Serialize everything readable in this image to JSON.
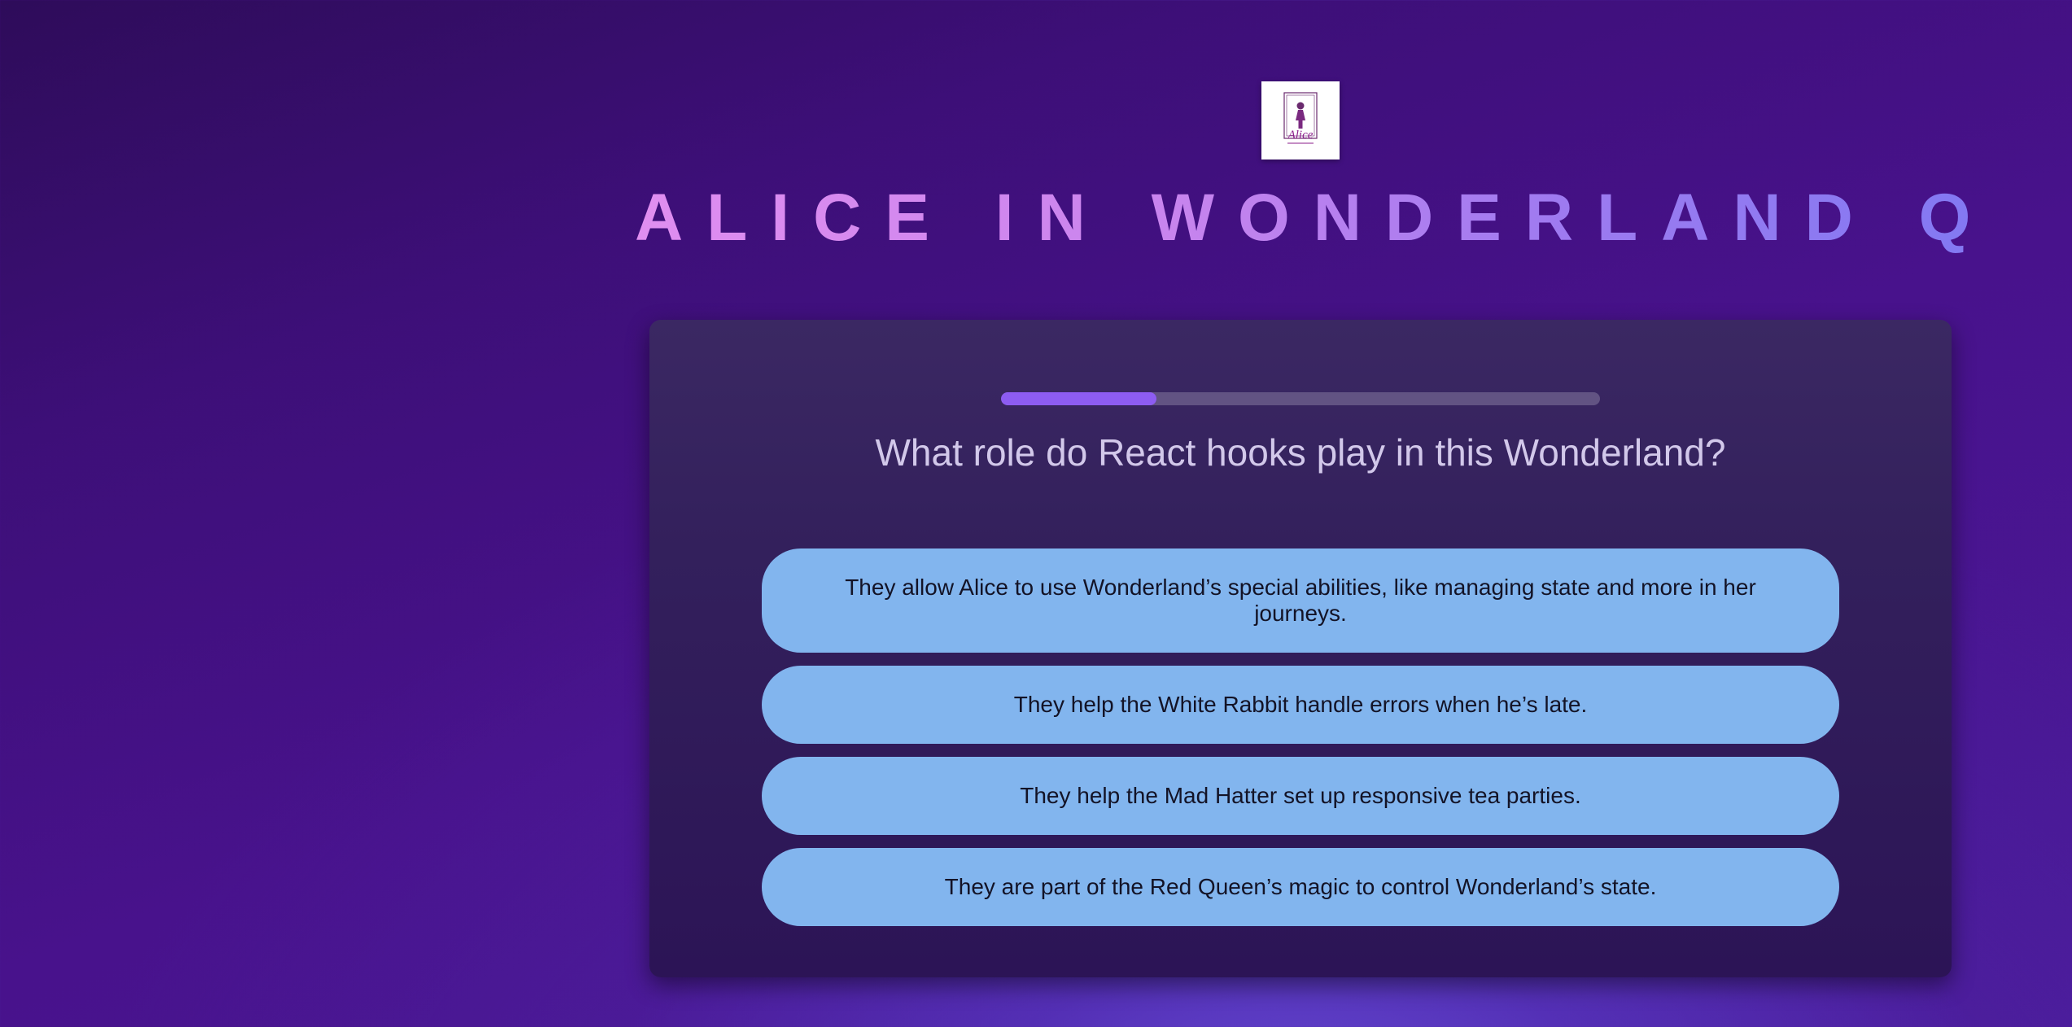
{
  "header": {
    "logo_icon": "alice-logo-icon",
    "logo_text": "Alice",
    "title": "ALICE IN WONDERLAND QUIZ"
  },
  "quiz": {
    "progress_fraction": 0.26,
    "progress_color": "#8d5cf2",
    "question": "What role do React hooks play in this Wonderland?",
    "answers": [
      "They allow Alice to use Wonderland’s special abilities, like managing state and more in her journeys.",
      "They help the White Rabbit handle errors when he’s late.",
      "They help the Mad Hatter set up responsive tea parties.",
      "They are part of the Red Queen’s magic to control Wonderland’s state."
    ]
  },
  "colors": {
    "answer_bg": "#82b5ee",
    "card_bg": "#33205c",
    "title_gradient_start": "#e08ef0",
    "title_gradient_end": "#8379f2"
  }
}
